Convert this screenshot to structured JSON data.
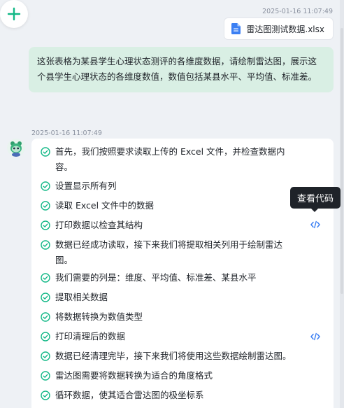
{
  "toolbar": {
    "new_chat_icon": "plus-icon",
    "accent_color": "#12b886"
  },
  "user_message": {
    "timestamp": "2025-01-16 11:07:49",
    "attachment": {
      "icon": "document-icon",
      "file_name": "雷达图测试数据.xlsx"
    },
    "text": "这张表格为某县学生心理状态测评的各维度数据，请绘制雷达图，展示这个县学生心理状态的各维度数值，数值包括某县水平、平均值、标准差。",
    "bubble_color": "#d9efe4"
  },
  "assistant_message": {
    "timestamp": "2025-01-16 11:07:49",
    "avatar_icon": "robot-avatar-icon",
    "steps": [
      {
        "text": "首先，我们按照要求读取上传的 Excel 文件，并检查数据内容。"
      },
      {
        "text": "设置显示所有列"
      },
      {
        "text": "读取 Excel 文件中的数据"
      },
      {
        "text": "打印数据以检查其结构"
      },
      {
        "text": "数据已经成功读取，接下来我们将提取相关列用于绘制雷达图。"
      },
      {
        "text": "我们需要的列是：维度、平均值、标准差、某县水平"
      },
      {
        "text": "提取相关数据"
      },
      {
        "text": "将数据转换为数值类型"
      },
      {
        "text": "打印清理后的数据"
      },
      {
        "text": "数据已经清理完毕，接下来我们将使用这些数据绘制雷达图。"
      },
      {
        "text": "雷达图需要将数据转换为适合的角度格式"
      },
      {
        "text": "循环数据，使其适合雷达图的极坐标系"
      }
    ],
    "check_icon": "check-circle-icon",
    "code_icon": "code-icon",
    "tooltip": "查看代码"
  }
}
